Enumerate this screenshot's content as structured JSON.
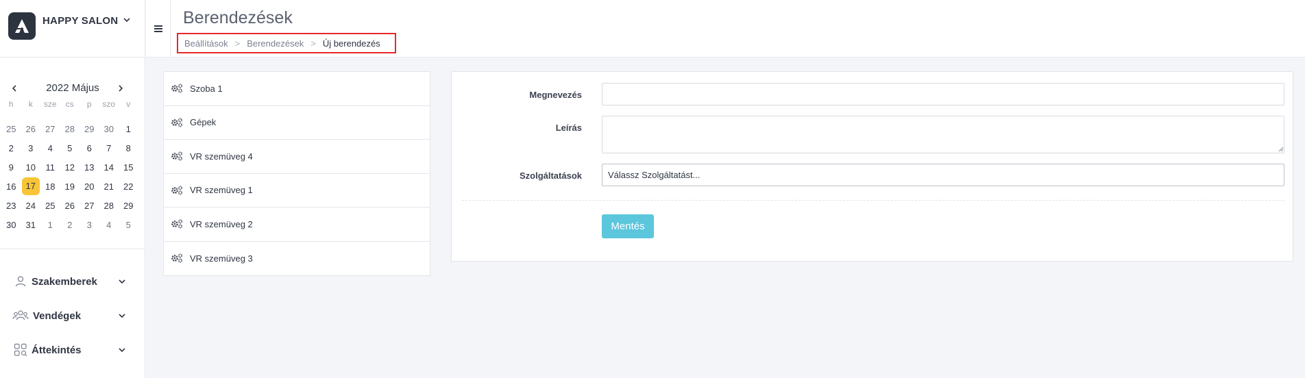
{
  "brand": {
    "name": "HAPPY SALON"
  },
  "calendar": {
    "title": "2022 Május",
    "weekdays": [
      "h",
      "k",
      "sze",
      "cs",
      "p",
      "szo",
      "v"
    ],
    "weeks": [
      [
        "25",
        "26",
        "27",
        "28",
        "29",
        "30",
        "1"
      ],
      [
        "2",
        "3",
        "4",
        "5",
        "6",
        "7",
        "8"
      ],
      [
        "9",
        "10",
        "11",
        "12",
        "13",
        "14",
        "15"
      ],
      [
        "16",
        "17",
        "18",
        "19",
        "20",
        "21",
        "22"
      ],
      [
        "23",
        "24",
        "25",
        "26",
        "27",
        "28",
        "29"
      ],
      [
        "30",
        "31",
        "1",
        "2",
        "3",
        "4",
        "5"
      ]
    ],
    "today": "17"
  },
  "nav": {
    "items": [
      {
        "label": "Szakemberek",
        "icon": "user-icon"
      },
      {
        "label": "Vendégek",
        "icon": "users-icon"
      },
      {
        "label": "Áttekintés",
        "icon": "grid-search-icon"
      }
    ]
  },
  "header": {
    "title": "Berendezések",
    "breadcrumb": [
      "Beállítások",
      "Berendezések",
      "Új berendezés"
    ],
    "separator": ">"
  },
  "equipment": [
    {
      "label": "Szoba 1",
      "icon": "cogs-icon"
    },
    {
      "label": "Gépek",
      "icon": "cogs-icon"
    },
    {
      "label": "VR szemüveg 4",
      "icon": "cogs-icon"
    },
    {
      "label": "VR szemüveg 1",
      "icon": "cogs-icon"
    },
    {
      "label": "VR szemüveg 2",
      "icon": "cogs-icon"
    },
    {
      "label": "VR szemüveg 3",
      "icon": "cogs-icon"
    }
  ],
  "form": {
    "name_label": "Megnevezés",
    "name_value": "",
    "desc_label": "Leírás",
    "desc_value": "",
    "services_label": "Szolgáltatások",
    "services_placeholder": "Válassz Szolgáltatást...",
    "save_label": "Mentés"
  },
  "colors": {
    "accent": "#5bc6dc",
    "today": "#f8c537",
    "highlight": "#e8262b",
    "dark": "#2e3340"
  }
}
